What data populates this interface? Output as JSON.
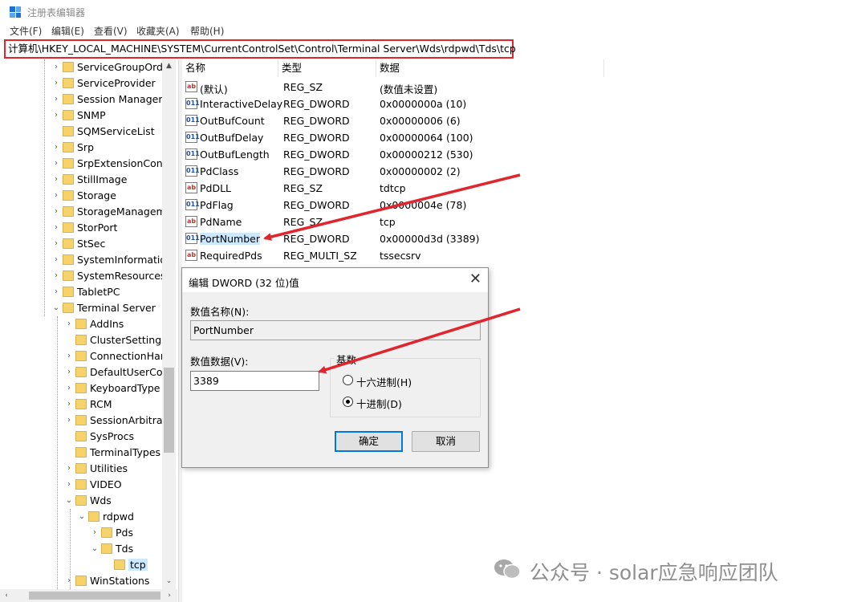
{
  "window": {
    "title": "注册表编辑器"
  },
  "menu": [
    "文件(F)",
    "编辑(E)",
    "查看(V)",
    "收藏夹(A)",
    "帮助(H)"
  ],
  "address": "计算机\\HKEY_LOCAL_MACHINE\\SYSTEM\\CurrentControlSet\\Control\\Terminal Server\\Wds\\rdpwd\\Tds\\tcp",
  "tree": [
    {
      "label": "ServiceGroupOrde",
      "chev": "›"
    },
    {
      "label": "ServiceProvider",
      "chev": "›"
    },
    {
      "label": "Session Manager",
      "chev": "›"
    },
    {
      "label": "SNMP",
      "chev": "›"
    },
    {
      "label": "SQMServiceList",
      "chev": ""
    },
    {
      "label": "Srp",
      "chev": "›"
    },
    {
      "label": "SrpExtensionConf",
      "chev": "›"
    },
    {
      "label": "StillImage",
      "chev": "›"
    },
    {
      "label": "Storage",
      "chev": "›"
    },
    {
      "label": "StorageManagem",
      "chev": "›"
    },
    {
      "label": "StorPort",
      "chev": "›"
    },
    {
      "label": "StSec",
      "chev": "›"
    },
    {
      "label": "SystemInformatio",
      "chev": "›"
    },
    {
      "label": "SystemResources",
      "chev": "›"
    },
    {
      "label": "TabletPC",
      "chev": "›"
    },
    {
      "label": "Terminal Server",
      "chev": "⌄"
    },
    {
      "label": "AddIns",
      "chev": "›"
    },
    {
      "label": "ClusterSettings",
      "chev": ""
    },
    {
      "label": "ConnectionHan",
      "chev": "›"
    },
    {
      "label": "DefaultUserCor",
      "chev": "›"
    },
    {
      "label": "KeyboardType",
      "chev": "›"
    },
    {
      "label": "RCM",
      "chev": "›"
    },
    {
      "label": "SessionArbitrat",
      "chev": "›"
    },
    {
      "label": "SysProcs",
      "chev": ""
    },
    {
      "label": "TerminalTypes",
      "chev": ""
    },
    {
      "label": "Utilities",
      "chev": "›"
    },
    {
      "label": "VIDEO",
      "chev": "›"
    },
    {
      "label": "Wds",
      "chev": "⌄"
    },
    {
      "label": "rdpwd",
      "chev": "⌄"
    },
    {
      "label": "Pds",
      "chev": "›"
    },
    {
      "label": "Tds",
      "chev": "⌄"
    },
    {
      "label": "tcp",
      "chev": ""
    },
    {
      "label": "WinStations",
      "chev": "›"
    }
  ],
  "columns": {
    "name": "名称",
    "type": "类型",
    "data": "数据"
  },
  "values": [
    {
      "name": "(默认)",
      "type": "REG_SZ",
      "data": "(数值未设置)",
      "icon": "ab"
    },
    {
      "name": "InteractiveDelay",
      "type": "REG_DWORD",
      "data": "0x0000000a (10)",
      "icon": "011"
    },
    {
      "name": "OutBufCount",
      "type": "REG_DWORD",
      "data": "0x00000006 (6)",
      "icon": "011"
    },
    {
      "name": "OutBufDelay",
      "type": "REG_DWORD",
      "data": "0x00000064 (100)",
      "icon": "011"
    },
    {
      "name": "OutBufLength",
      "type": "REG_DWORD",
      "data": "0x00000212 (530)",
      "icon": "011"
    },
    {
      "name": "PdClass",
      "type": "REG_DWORD",
      "data": "0x00000002 (2)",
      "icon": "011"
    },
    {
      "name": "PdDLL",
      "type": "REG_SZ",
      "data": "tdtcp",
      "icon": "ab"
    },
    {
      "name": "PdFlag",
      "type": "REG_DWORD",
      "data": "0x0000004e (78)",
      "icon": "011"
    },
    {
      "name": "PdName",
      "type": "REG_SZ",
      "data": "tcp",
      "icon": "ab"
    },
    {
      "name": "PortNumber",
      "type": "REG_DWORD",
      "data": "0x00000d3d (3389)",
      "icon": "011"
    },
    {
      "name": "RequiredPds",
      "type": "REG_MULTI_SZ",
      "data": "tssecsrv",
      "icon": "ab"
    }
  ],
  "dialog": {
    "title": "编辑 DWORD (32 位)值",
    "close": "✕",
    "name_label": "数值名称(N):",
    "name_value": "PortNumber",
    "data_label": "数值数据(V):",
    "data_value": "3389",
    "base_label": "基数",
    "radio_hex": "十六进制(H)",
    "radio_dec": "十进制(D)",
    "selected_base": "dec",
    "ok": "确定",
    "cancel": "取消"
  },
  "watermark": "公众号 · solar应急响应团队",
  "colors": {
    "highlight_box": "#e0262c",
    "arrow": "#e0262c",
    "selection": "#cce8ff",
    "folder": "#f6d26b"
  }
}
